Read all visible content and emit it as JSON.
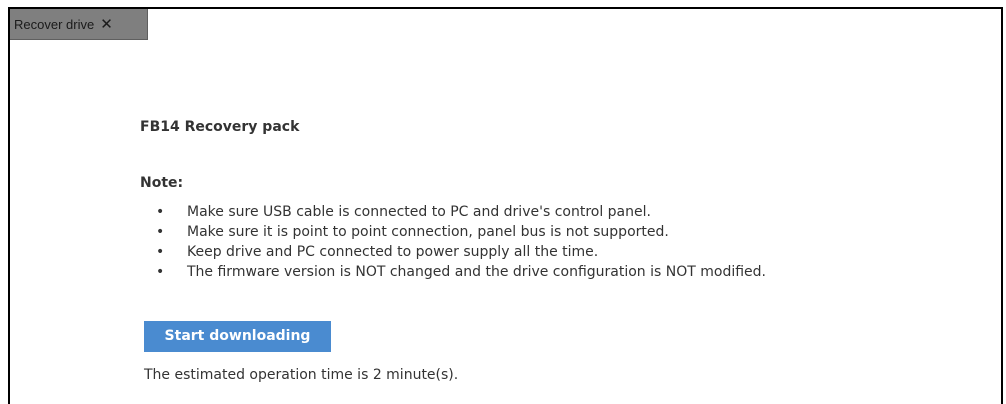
{
  "tab": {
    "label": "Recover drive",
    "close_glyph": "✕",
    "close_icon": "close-icon"
  },
  "main": {
    "title": "FB14 Recovery pack",
    "note_heading": "Note:",
    "bullet_glyph": "•",
    "notes": [
      "Make sure USB cable is connected to PC and drive's control panel.",
      "Make sure it is point to point connection, panel bus is not supported.",
      "Keep drive and PC connected to power supply all the time.",
      "The firmware version is NOT changed and the drive configuration is NOT modified."
    ],
    "start_button_label": "Start downloading",
    "estimate_text": "The estimated operation time is 2 minute(s)."
  },
  "colors": {
    "tab_background": "#7f7f7f",
    "button_background": "#4a8bd0",
    "button_text": "#ffffff",
    "body_text": "#333333",
    "frame_border": "#000000"
  }
}
